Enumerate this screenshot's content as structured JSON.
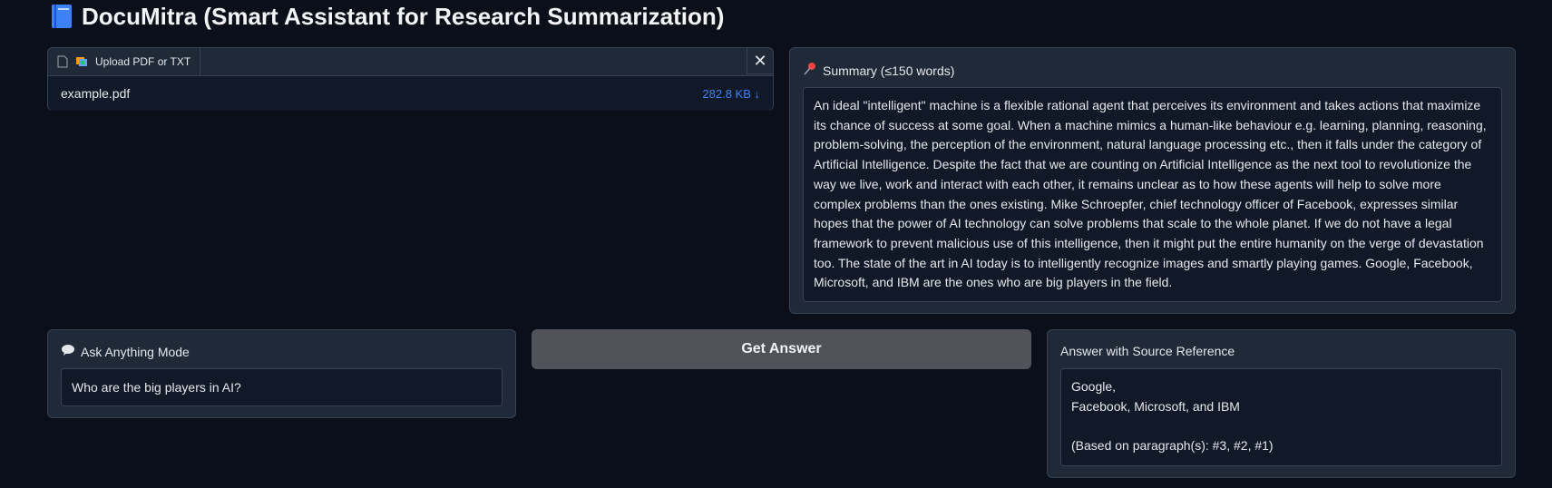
{
  "header": {
    "title": "DocuMitra (Smart Assistant for Research Summarization)",
    "icon": "blue-book-icon"
  },
  "upload": {
    "tab_label": "Upload PDF or TXT",
    "file_name": "example.pdf",
    "file_size": "282.8 KB ↓",
    "close_glyph": "✕"
  },
  "summary": {
    "label": "Summary (≤150 words)",
    "text": "An ideal \"intelligent\" machine is a flexible rational agent that perceives its environment and takes actions that maximize its chance of success at some goal. When a machine mimics a human-like behaviour e.g. learning, planning, reasoning, problem-solving, the perception of the environment, natural language processing etc., then it falls under the category of Artificial Intelligence. Despite the fact that we are counting on Artificial Intelligence as the next tool to revolutionize the way we live, work and interact with each other, it remains unclear as to how these agents will help to solve more complex problems than the ones existing. Mike Schroepfer, chief technology officer of Facebook, expresses similar hopes that the power of AI technology can solve problems that scale to the whole planet. If we do not have a legal framework to prevent malicious use of this intelligence, then it might put the entire humanity on the verge of devastation too. The state of the art in AI today is to intelligently recognize images and smartly playing games. Google, Facebook, Microsoft, and IBM are the ones who are big players in the field."
  },
  "ask": {
    "label": "Ask Anything Mode",
    "value": "Who are the big players in AI?"
  },
  "get_answer_button": "Get Answer",
  "answer": {
    "label": "Answer with Source Reference",
    "text": "Google,\nFacebook, Microsoft, and IBM\n\n(Based on paragraph(s): #3, #2, #1)"
  },
  "colors": {
    "background": "#0b0f19",
    "panel": "#1f2937",
    "input": "#111827",
    "accent_link": "#3b82f6",
    "button": "#52525b"
  }
}
